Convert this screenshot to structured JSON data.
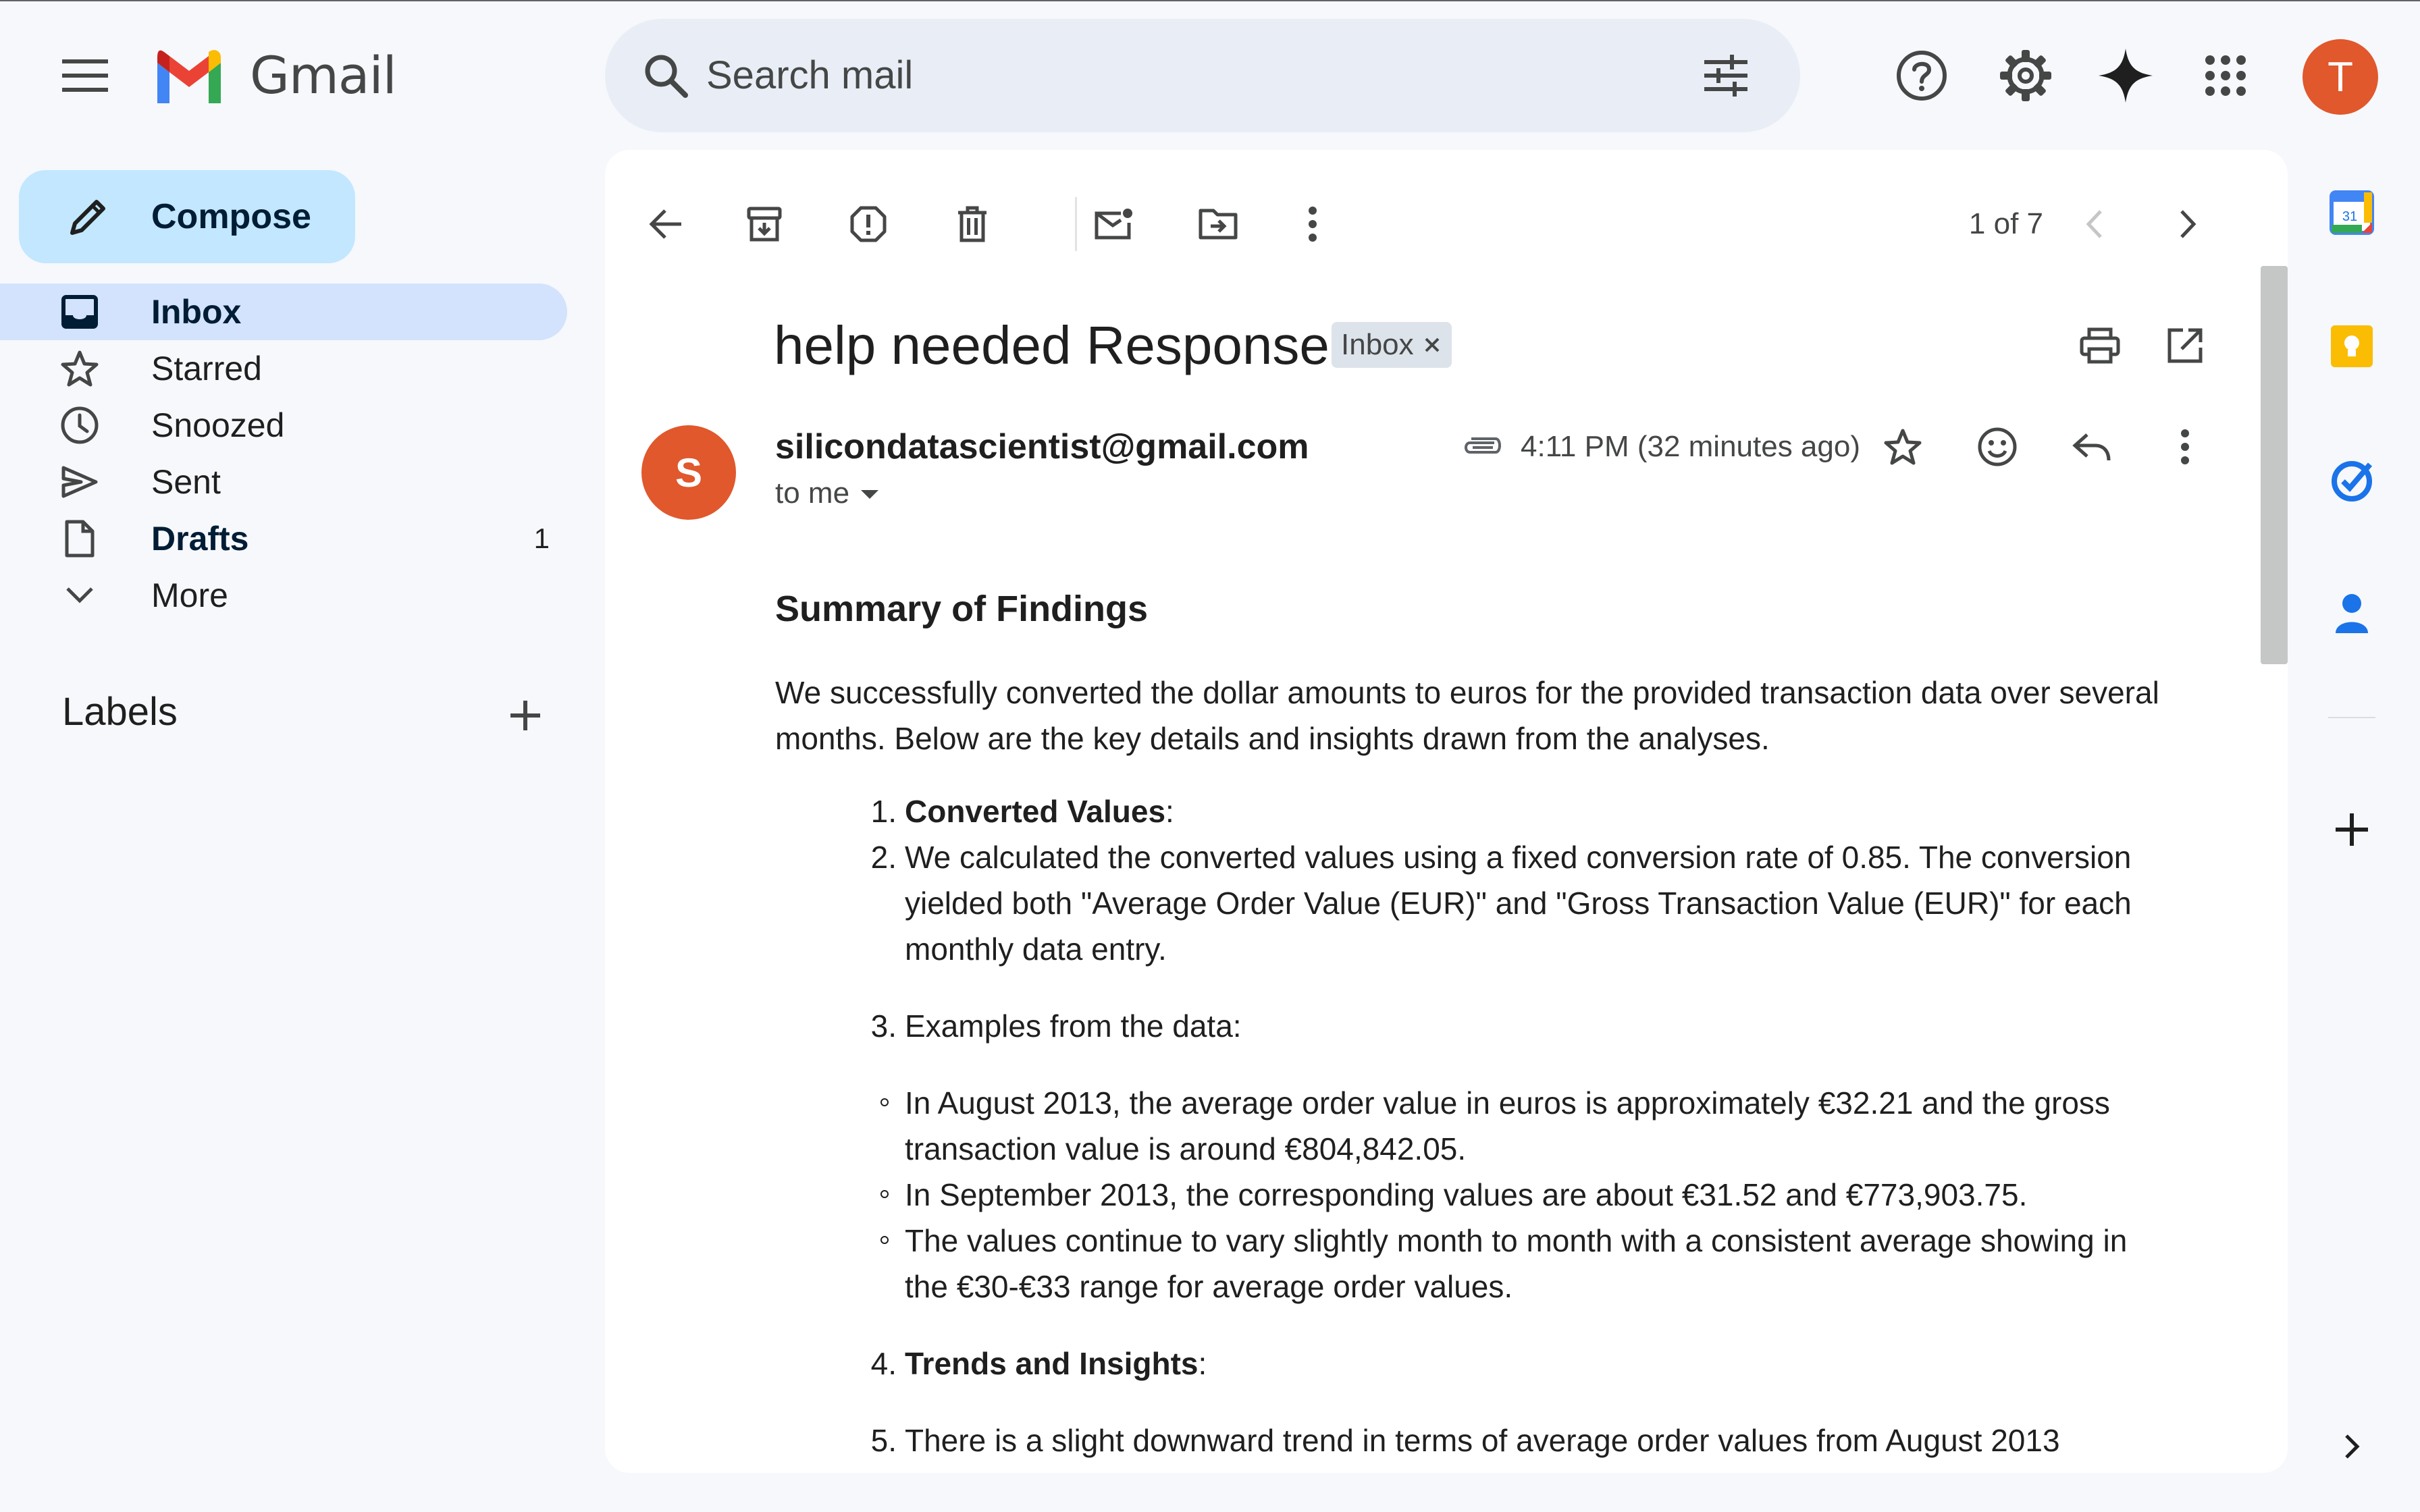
{
  "app": {
    "brand": "Gmail",
    "accent": "#0b57d0",
    "avatar_color": "#e0582c"
  },
  "header": {
    "search_placeholder": "Search mail",
    "user_initial": "T"
  },
  "sidebar": {
    "compose_label": "Compose",
    "items": [
      {
        "label": "Inbox",
        "icon": "inbox-icon",
        "active": true,
        "bold": true,
        "count": ""
      },
      {
        "label": "Starred",
        "icon": "star-icon",
        "active": false,
        "bold": false,
        "count": ""
      },
      {
        "label": "Snoozed",
        "icon": "clock-icon",
        "active": false,
        "bold": false,
        "count": ""
      },
      {
        "label": "Sent",
        "icon": "send-icon",
        "active": false,
        "bold": false,
        "count": ""
      },
      {
        "label": "Drafts",
        "icon": "draft-icon",
        "active": false,
        "bold": true,
        "count": "1"
      },
      {
        "label": "More",
        "icon": "chevron-down-icon",
        "active": false,
        "bold": false,
        "count": ""
      }
    ],
    "labels_title": "Labels"
  },
  "toolbar": {
    "pager": "1 of 7"
  },
  "email": {
    "subject": "help needed Response",
    "chip_label": "Inbox",
    "sender_initial": "S",
    "sender": "silicondatascientist@gmail.com",
    "to": "to me",
    "timestamp": "4:11 PM (32 minutes ago)",
    "heading": "Summary of Findings",
    "intro": "We successfully converted the dollar amounts to euros for the provided transaction data over several months. Below are the key details and insights drawn from the analyses.",
    "list": [
      {
        "num": "1.",
        "bold": "Converted Values",
        "text": ":"
      },
      {
        "num": "2.",
        "bold": "",
        "text": "We calculated the converted values using a fixed conversion rate of 0.85. The conversion yielded both \"Average Order Value (EUR)\" and \"Gross Transaction Value (EUR)\" for each monthly data entry."
      },
      {
        "num": "3.",
        "bold": "",
        "text": "Examples from the data:"
      }
    ],
    "examples": [
      "In August 2013, the average order value in euros is approximately €32.21 and the gross transaction value is around €804,842.05.",
      "In September 2013, the corresponding values are about €31.52 and €773,903.75.",
      "The values continue to vary slightly month to month with a consistent average showing in the €30-€33 range for average order values."
    ],
    "list2": [
      {
        "num": "4.",
        "bold": "Trends and Insights",
        "text": ":"
      },
      {
        "num": "5.",
        "bold": "",
        "text": "There is a slight downward trend in terms of average order values from August 2013 through"
      }
    ]
  }
}
